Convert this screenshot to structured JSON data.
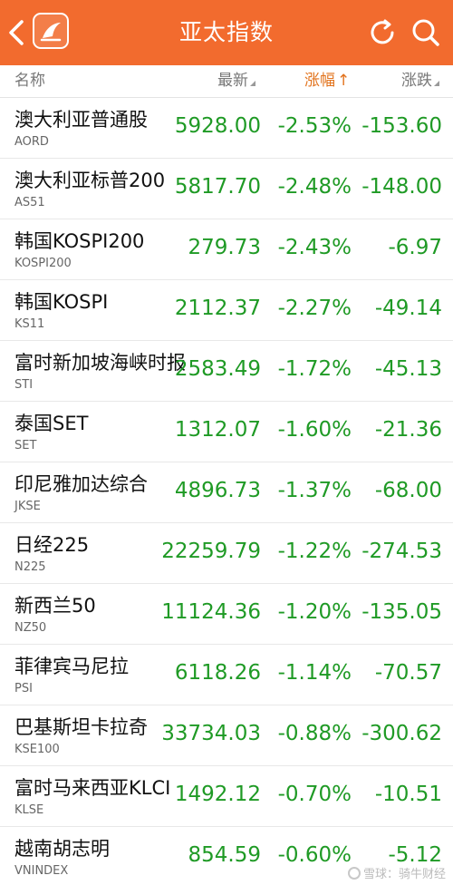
{
  "colors": {
    "header_bg": "#f26b2e",
    "value_green": "#1f9a25",
    "active_sort": "#e2731d"
  },
  "header": {
    "title": "亚太指数",
    "icons": [
      "chevron-left-icon",
      "app-logo-icon",
      "refresh-icon",
      "search-icon"
    ]
  },
  "columns": {
    "name": "名称",
    "latest": "最新",
    "change_pct": "涨幅",
    "change_pct_arrow": "↑",
    "change": "涨跌"
  },
  "rows": [
    {
      "name": "澳大利亚普通股",
      "code": "AORD",
      "latest": "5928.00",
      "change_pct": "-2.53%",
      "change": "-153.60"
    },
    {
      "name": "澳大利亚标普200",
      "code": "AS51",
      "latest": "5817.70",
      "change_pct": "-2.48%",
      "change": "-148.00"
    },
    {
      "name": "韩国KOSPI200",
      "code": "KOSPI200",
      "latest": "279.73",
      "change_pct": "-2.43%",
      "change": "-6.97"
    },
    {
      "name": "韩国KOSPI",
      "code": "KS11",
      "latest": "2112.37",
      "change_pct": "-2.27%",
      "change": "-49.14"
    },
    {
      "name": "富时新加坡海峡时报",
      "code": "STI",
      "latest": "2583.49",
      "change_pct": "-1.72%",
      "change": "-45.13"
    },
    {
      "name": "泰国SET",
      "code": "SET",
      "latest": "1312.07",
      "change_pct": "-1.60%",
      "change": "-21.36"
    },
    {
      "name": "印尼雅加达综合",
      "code": "JKSE",
      "latest": "4896.73",
      "change_pct": "-1.37%",
      "change": "-68.00"
    },
    {
      "name": "日经225",
      "code": "N225",
      "latest": "22259.79",
      "change_pct": "-1.22%",
      "change": "-274.53"
    },
    {
      "name": "新西兰50",
      "code": "NZ50",
      "latest": "11124.36",
      "change_pct": "-1.20%",
      "change": "-135.05"
    },
    {
      "name": "菲律宾马尼拉",
      "code": "PSI",
      "latest": "6118.26",
      "change_pct": "-1.14%",
      "change": "-70.57"
    },
    {
      "name": "巴基斯坦卡拉奇",
      "code": "KSE100",
      "latest": "33734.03",
      "change_pct": "-0.88%",
      "change": "-300.62"
    },
    {
      "name": "富时马来西亚KLCI",
      "code": "KLSE",
      "latest": "1492.12",
      "change_pct": "-0.70%",
      "change": "-10.51"
    },
    {
      "name": "越南胡志明",
      "code": "VNINDEX",
      "latest": "854.59",
      "change_pct": "-0.60%",
      "change": "-5.12"
    }
  ],
  "watermark": "雪球：骑牛财经"
}
